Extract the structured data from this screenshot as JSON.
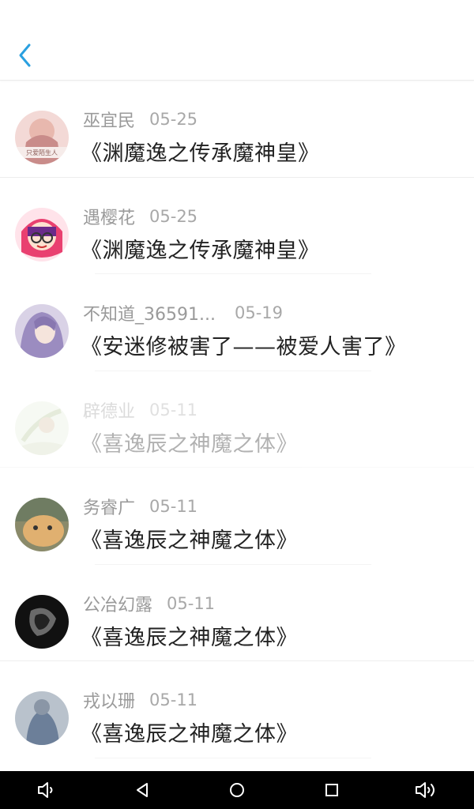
{
  "colors": {
    "accent": "#2aa0e0",
    "name": "#9a9a9a",
    "title": "#222222",
    "navbar": "#000000"
  },
  "header": {
    "back_icon": "chevron-left-icon"
  },
  "items": [
    {
      "name": "巫宜民",
      "date": "05-25",
      "title": "《渊魔逸之传承魔神皇》",
      "faded": false
    },
    {
      "name": "遇樱花",
      "date": "05-25",
      "title": "《渊魔逸之传承魔神皇》",
      "faded": false
    },
    {
      "name": "不知道_36591...",
      "date": "05-19",
      "title": "《安迷修被害了——被爱人害了》",
      "faded": false
    },
    {
      "name": "辟德业",
      "date": "05-11",
      "title": "《喜逸辰之神魔之体》",
      "faded": true
    },
    {
      "name": "务睿广",
      "date": "05-11",
      "title": "《喜逸辰之神魔之体》",
      "faded": false
    },
    {
      "name": "公冶幻露",
      "date": "05-11",
      "title": "《喜逸辰之神魔之体》",
      "faded": false
    },
    {
      "name": "戎以珊",
      "date": "05-11",
      "title": "《喜逸辰之神魔之体》",
      "faded": false
    }
  ],
  "avatar_caption": "只爱陌生人",
  "navbar": {
    "icons": [
      "volume-down-icon",
      "back-triangle-icon",
      "home-circle-icon",
      "recents-square-icon",
      "volume-up-icon"
    ]
  }
}
